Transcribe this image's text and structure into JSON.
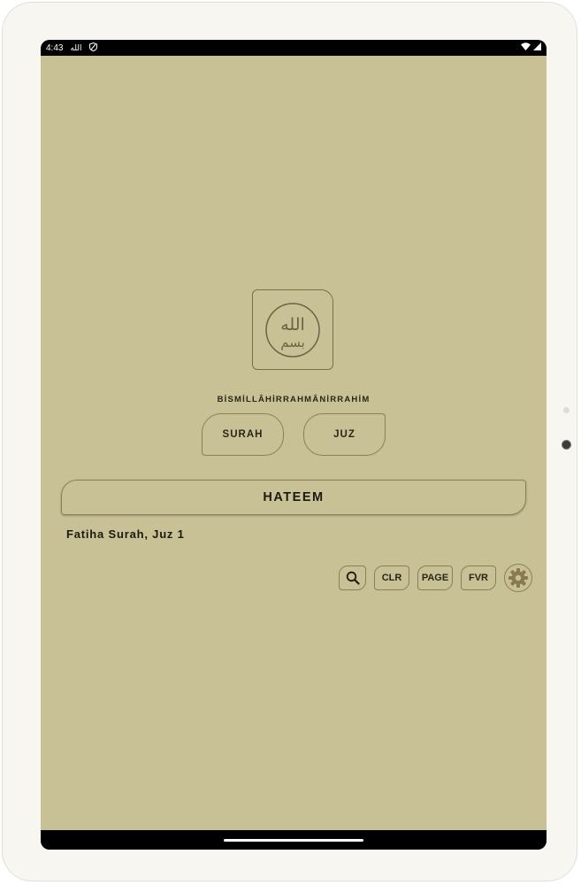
{
  "status_bar": {
    "time": "4:43",
    "notification_glyph": "الله",
    "icons": [
      "vpn-shield-icon",
      "wifi-icon",
      "cellular-signal-icon"
    ]
  },
  "logo": {
    "icon": "bismillah-calligraphy-icon",
    "calligraphy_top": "الله",
    "calligraphy_bottom": "بسم"
  },
  "header": {
    "bismillah_text": "BİSMİLLÂHİRRAHMÂNİRRAHİM"
  },
  "buttons": {
    "surah_label": "SURAH",
    "juz_label": "JUZ"
  },
  "main": {
    "hateem_label": "HATEEM",
    "location_text": "Fatiha Surah, Juz 1"
  },
  "toolbar": {
    "search_icon": "search-icon",
    "clr_label": "CLR",
    "page_label": "PAGE",
    "fvr_label": "FVR",
    "settings_icon": "gear-icon"
  },
  "colors": {
    "background": "#c8c195",
    "border": "#8a7f5c",
    "text": "#1c1a10"
  }
}
